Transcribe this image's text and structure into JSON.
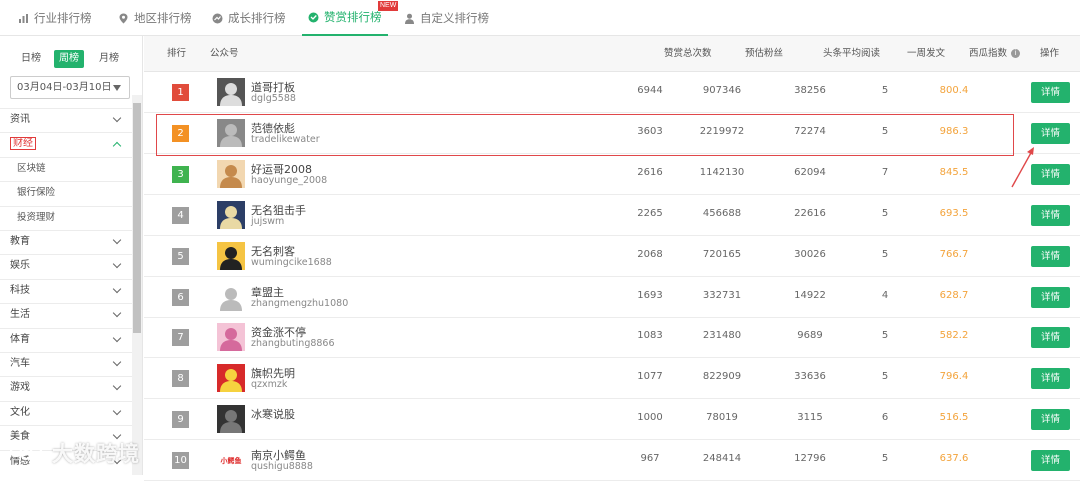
{
  "tabs": [
    {
      "label": "行业排行榜",
      "icon": "bar-chart-icon"
    },
    {
      "label": "地区排行榜",
      "icon": "location-pin-icon"
    },
    {
      "label": "成长排行榜",
      "icon": "growth-icon"
    },
    {
      "label": "赞赏排行榜",
      "icon": "reward-icon",
      "active": true,
      "badge": "NEW"
    },
    {
      "label": "自定义排行榜",
      "icon": "user-icon"
    }
  ],
  "sidebar": {
    "periods": [
      "日榜",
      "周榜",
      "月榜"
    ],
    "active_period": "周榜",
    "date_range": "03月04日-03月10日",
    "categories": [
      {
        "label": "资讯"
      },
      {
        "label": "财经",
        "active": true
      },
      {
        "label": "区块链",
        "sub": true
      },
      {
        "label": "银行保险",
        "sub": true
      },
      {
        "label": "投资理财",
        "sub": true
      },
      {
        "label": "教育"
      },
      {
        "label": "娱乐"
      },
      {
        "label": "科技"
      },
      {
        "label": "生活"
      },
      {
        "label": "体育"
      },
      {
        "label": "汽车"
      },
      {
        "label": "游戏"
      },
      {
        "label": "文化"
      },
      {
        "label": "美食"
      },
      {
        "label": "情感"
      }
    ]
  },
  "watermark": "大数跨境",
  "table": {
    "headers": {
      "rank": "排行",
      "account": "公众号",
      "reward_count": "赞赏总次数",
      "est_fans": "预估粉丝",
      "avg_reads": "头条平均阅读",
      "weekly_posts": "一周发文",
      "xigua_index": "西瓜指数",
      "action": "操作"
    },
    "detail_label": "详情",
    "rows": [
      {
        "rank": "1",
        "name": "道哥打板",
        "id": "dglg5588",
        "rewards": "6944",
        "fans": "907346",
        "reads": "38256",
        "posts": "5",
        "index": "800.4",
        "rank_color": "#e14c3b"
      },
      {
        "rank": "2",
        "name": "范德依彪",
        "id": "tradelikewater",
        "rewards": "3603",
        "fans": "2219972",
        "reads": "72274",
        "posts": "5",
        "index": "986.3",
        "rank_color": "#f39124"
      },
      {
        "rank": "3",
        "name": "好运哥2008",
        "id": "haoyunge_2008",
        "rewards": "2616",
        "fans": "1142130",
        "reads": "62094",
        "posts": "7",
        "index": "845.5",
        "rank_color": "#3fb34f"
      },
      {
        "rank": "4",
        "name": "无名狙击手",
        "id": "jujswm",
        "rewards": "2265",
        "fans": "456688",
        "reads": "22616",
        "posts": "5",
        "index": "693.5",
        "rank_color": "#9e9e9e"
      },
      {
        "rank": "5",
        "name": "无名刺客",
        "id": "wumingcike1688",
        "rewards": "2068",
        "fans": "720165",
        "reads": "30026",
        "posts": "5",
        "index": "766.7",
        "rank_color": "#9e9e9e"
      },
      {
        "rank": "6",
        "name": "章盟主",
        "id": "zhangmengzhu1080",
        "rewards": "1693",
        "fans": "332731",
        "reads": "14922",
        "posts": "4",
        "index": "628.7",
        "rank_color": "#9e9e9e"
      },
      {
        "rank": "7",
        "name": "资金涨不停",
        "id": "zhangbuting8866",
        "rewards": "1083",
        "fans": "231480",
        "reads": "9689",
        "posts": "5",
        "index": "582.2",
        "rank_color": "#9e9e9e"
      },
      {
        "rank": "8",
        "name": "旗帜先明",
        "id": "qzxmzk",
        "rewards": "1077",
        "fans": "822909",
        "reads": "33636",
        "posts": "5",
        "index": "796.4",
        "rank_color": "#9e9e9e"
      },
      {
        "rank": "9",
        "name": "冰寒说股",
        "id": "",
        "rewards": "1000",
        "fans": "78019",
        "reads": "3115",
        "posts": "6",
        "index": "516.5",
        "rank_color": "#9e9e9e"
      },
      {
        "rank": "10",
        "name": "南京小鳄鱼",
        "id": "qushigu8888",
        "rewards": "967",
        "fans": "248414",
        "reads": "12796",
        "posts": "5",
        "index": "637.6",
        "rank_color": "#9e9e9e",
        "avatar_text": "小鳄鱼"
      }
    ]
  }
}
